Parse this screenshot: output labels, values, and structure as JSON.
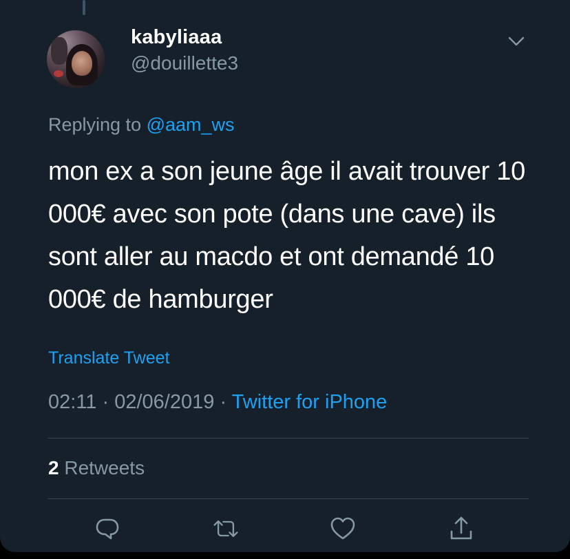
{
  "tweet": {
    "author": {
      "display_name": "kabyliaaa",
      "handle": "@douillette3"
    },
    "replying_prefix": "Replying to ",
    "replying_to": "@aam_ws",
    "text": "mon ex a son jeune âge il avait trouver 10 000€ avec son pote (dans une cave) ils sont aller au macdo et ont demandé 10 000€ de hamburger",
    "translate_label": "Translate Tweet",
    "time": "02:11",
    "date": "02/06/2019",
    "separator": "·",
    "source": "Twitter for iPhone",
    "retweet_count": "2",
    "retweet_label": "Retweets"
  },
  "icons": {
    "more": "chevron-down-icon",
    "reply": "reply-icon",
    "retweet": "retweet-icon",
    "like": "heart-icon",
    "share": "share-icon"
  },
  "colors": {
    "background": "#15202b",
    "accent": "#1da1f2",
    "secondary_text": "#8899a6",
    "primary_text": "#ffffff"
  }
}
